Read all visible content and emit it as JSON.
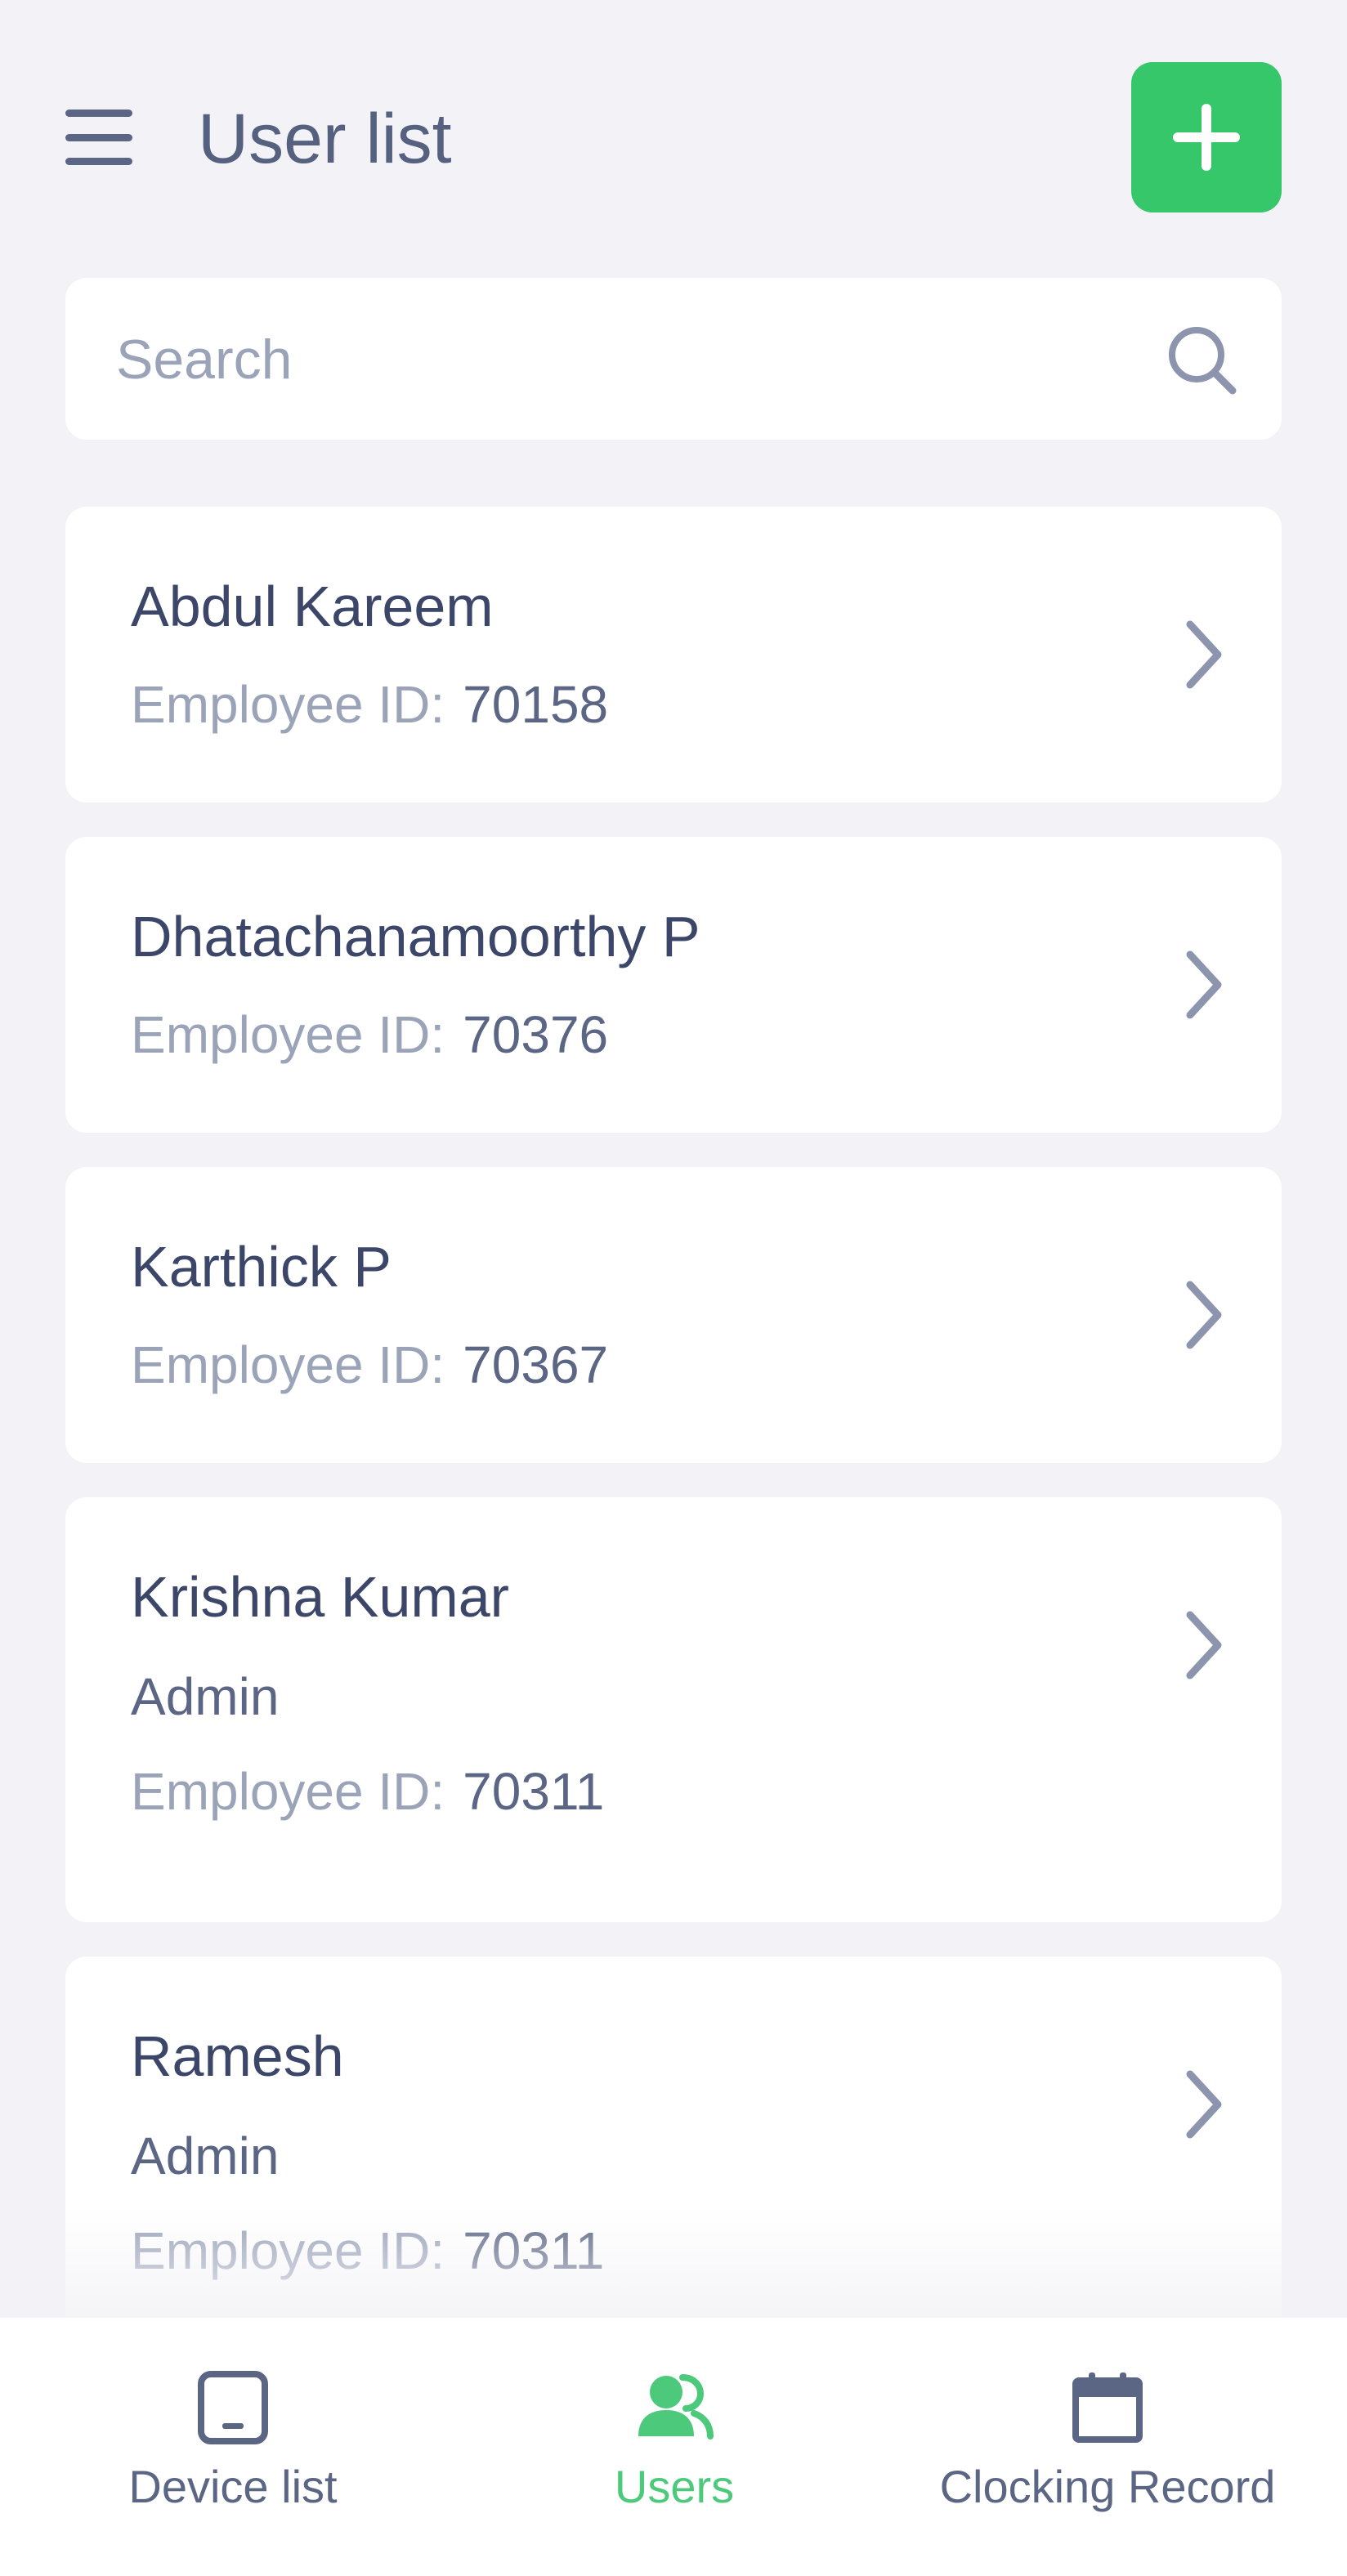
{
  "header": {
    "title": "User list",
    "menu_icon": "hamburger-menu-icon",
    "add_icon": "plus-icon",
    "add_color": "#35c76a"
  },
  "search": {
    "placeholder": "Search",
    "value": "",
    "icon": "search-icon"
  },
  "users": [
    {
      "name": "Abdul Kareem",
      "role": "",
      "employee_id_label": "Employee ID:",
      "employee_id": "70158"
    },
    {
      "name": "Dhatachanamoorthy P",
      "role": "",
      "employee_id_label": "Employee ID:",
      "employee_id": "70376"
    },
    {
      "name": "Karthick P",
      "role": "",
      "employee_id_label": "Employee ID:",
      "employee_id": "70367"
    },
    {
      "name": "Krishna Kumar",
      "role": "Admin",
      "employee_id_label": "Employee ID:",
      "employee_id": "70311"
    },
    {
      "name": "Ramesh",
      "role": "Admin",
      "employee_id_label": "Employee ID:",
      "employee_id": "70311"
    }
  ],
  "tabbar": {
    "tabs": [
      {
        "label": "Device list",
        "icon": "tablet-device-icon",
        "active": false
      },
      {
        "label": "Users",
        "icon": "users-icon",
        "active": true
      },
      {
        "label": "Clocking Record",
        "icon": "calendar-icon",
        "active": false
      }
    ],
    "active_color": "#4cc97a",
    "inactive_color": "#5b6584"
  }
}
